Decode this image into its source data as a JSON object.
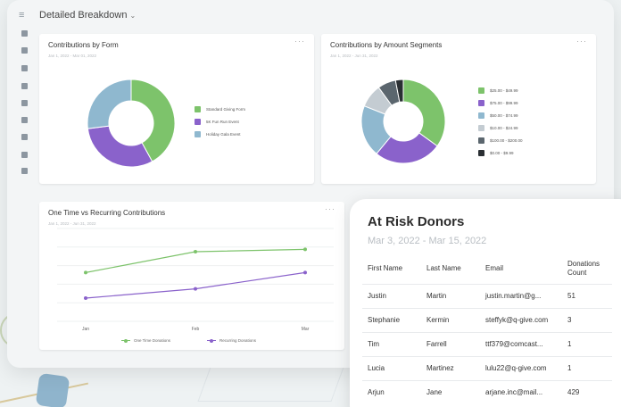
{
  "dashboard": {
    "title": "Detailed Breakdown"
  },
  "colors": {
    "green": "#7dc36b",
    "purple": "#8a62cb",
    "blue": "#8fb8cf",
    "light_gray": "#c4ccd2",
    "dark_gray": "#5b666e",
    "black": "#2a2f33"
  },
  "cards": {
    "form": {
      "title": "Contributions by Form",
      "date": "Jan 1, 2022 - Mar 01, 2022"
    },
    "segments": {
      "title": "Contributions by Amount Segments",
      "date": "Jan 1, 2022 - Jun 31, 2022"
    },
    "recurring": {
      "title": "One Time vs Recurring Contributions",
      "date": "Jan 1, 2022 - Jun 31, 2022"
    }
  },
  "chart_data": [
    {
      "type": "pie",
      "title": "Contributions by Form",
      "categories": [
        "Standard Giving Form",
        "5K Fun Run Event",
        "Holiday Gala Event"
      ],
      "values": [
        42,
        31,
        27
      ],
      "colors": [
        "#7dc36b",
        "#8a62cb",
        "#8fb8cf"
      ],
      "legend": "right"
    },
    {
      "type": "pie",
      "title": "Contributions by Amount Segments",
      "categories": [
        "$25.00 - $49.99",
        "$75.00 - $99.99",
        "$50.00 - $74.99",
        "$10.00 - $24.99",
        "$100.00 - $200.00",
        "$0.00 - $9.99"
      ],
      "values": [
        35,
        26,
        20,
        9,
        7,
        3
      ],
      "colors": [
        "#7dc36b",
        "#8a62cb",
        "#8fb8cf",
        "#c4ccd2",
        "#5b666e",
        "#2a2f33"
      ],
      "legend": "right"
    },
    {
      "type": "line",
      "title": "One Time vs Recurring Contributions",
      "categories": [
        "Jan",
        "Feb",
        "Mar"
      ],
      "series": [
        {
          "name": "One Time Donations",
          "values": [
            62,
            80,
            82
          ],
          "color": "#7dc36b"
        },
        {
          "name": "Recurring Donations",
          "values": [
            40,
            48,
            62
          ],
          "color": "#8a62cb"
        }
      ],
      "ylim": [
        20,
        100
      ],
      "grid": true,
      "legend": "bottom"
    }
  ],
  "donors": {
    "title": "At Risk Donors",
    "range": "Mar 3, 2022 - Mar 15, 2022",
    "headers": [
      "First Name",
      "Last Name",
      "Email",
      "Donations Count"
    ],
    "rows": [
      [
        "Justin",
        "Martin",
        "justin.martin@g...",
        "51"
      ],
      [
        "Stephanie",
        "Kermin",
        "steffyk@q-give.com",
        "3"
      ],
      [
        "Tim",
        "Farrell",
        "ttf379@comcast...",
        "1"
      ],
      [
        "Lucia",
        "Martinez",
        "lulu22@q-give.com",
        "1"
      ],
      [
        "Arjun",
        "Jane",
        "arjane.inc@mail...",
        "429"
      ]
    ]
  }
}
